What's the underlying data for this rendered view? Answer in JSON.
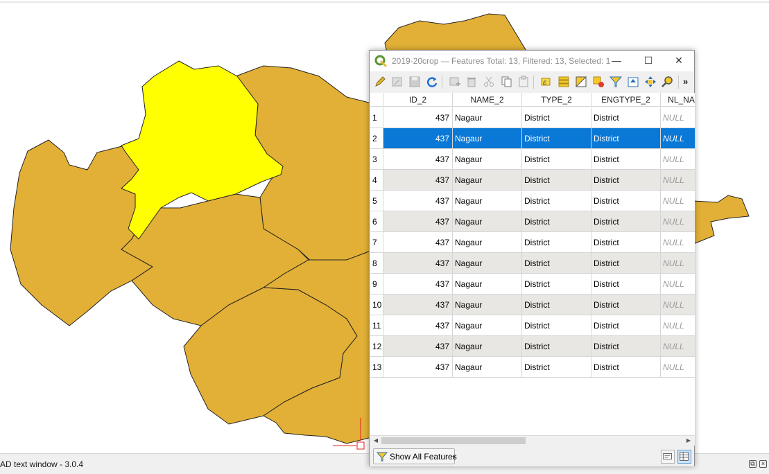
{
  "dialog": {
    "title": "2019-20crop — Features Total: 13, Filtered: 13, Selected: 1",
    "window_controls": {
      "minimize": "—",
      "maximize": "☐",
      "close": "✕"
    },
    "toolbar_icons": [
      "pencil-icon",
      "multi-edit-icon",
      "save-icon",
      "reload-icon",
      "add-feature-icon",
      "delete-feature-icon",
      "cut-icon",
      "copy-icon",
      "paste-icon",
      "select-expression-icon",
      "select-all-icon",
      "invert-selection-icon",
      "deselect-icon",
      "filter-icon",
      "move-to-top-icon",
      "pan-to-selection-icon",
      "zoom-to-selection-icon"
    ],
    "toolbar_more": "»",
    "columns": [
      "ID_2",
      "NAME_2",
      "TYPE_2",
      "ENGTYPE_2",
      "NL_NA"
    ],
    "rows": [
      [
        "1",
        "437",
        "Nagaur",
        "District",
        "District",
        "NULL"
      ],
      [
        "2",
        "437",
        "Nagaur",
        "District",
        "District",
        "NULL"
      ],
      [
        "3",
        "437",
        "Nagaur",
        "District",
        "District",
        "NULL"
      ],
      [
        "4",
        "437",
        "Nagaur",
        "District",
        "District",
        "NULL"
      ],
      [
        "5",
        "437",
        "Nagaur",
        "District",
        "District",
        "NULL"
      ],
      [
        "6",
        "437",
        "Nagaur",
        "District",
        "District",
        "NULL"
      ],
      [
        "7",
        "437",
        "Nagaur",
        "District",
        "District",
        "NULL"
      ],
      [
        "8",
        "437",
        "Nagaur",
        "District",
        "District",
        "NULL"
      ],
      [
        "9",
        "437",
        "Nagaur",
        "District",
        "District",
        "NULL"
      ],
      [
        "10",
        "437",
        "Nagaur",
        "District",
        "District",
        "NULL"
      ],
      [
        "11",
        "437",
        "Nagaur",
        "District",
        "District",
        "NULL"
      ],
      [
        "12",
        "437",
        "Nagaur",
        "District",
        "District",
        "NULL"
      ],
      [
        "13",
        "437",
        "Nagaur",
        "District",
        "District",
        "NULL"
      ]
    ],
    "selected_row": 2,
    "show_all_label": "Show All Features"
  },
  "statusbar": {
    "text": "AD text window - 3.0.4"
  },
  "colors": {
    "district_fill": "#e2b036",
    "selected_district_fill": "#ffff00",
    "selection_highlight": "#0a78d7",
    "alt_row": "#e9e7e3"
  }
}
